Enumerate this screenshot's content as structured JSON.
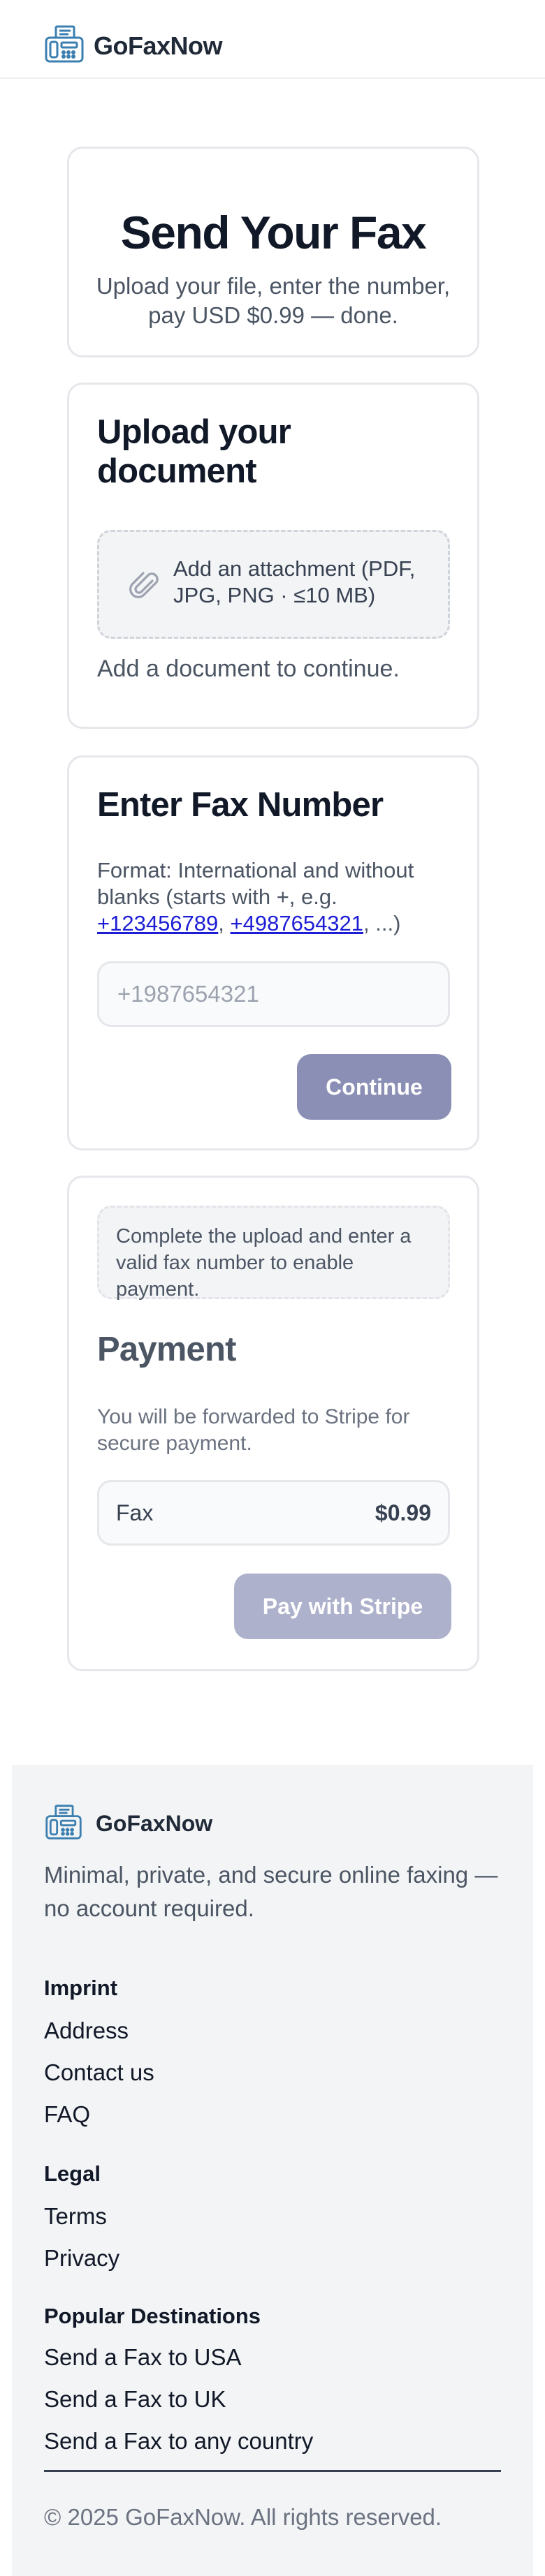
{
  "header": {
    "brand": "GoFaxNow",
    "logo_icon": "fax-machine-icon"
  },
  "hero": {
    "title": "Send Your Fax",
    "subtitle": "Upload your file, enter the number, pay USD $0.99 — done."
  },
  "upload": {
    "title": "Upload your document",
    "dropzone_label": "Add an attachment (PDF, JPG, PNG · ≤10 MB)",
    "dropzone_icon": "paperclip-icon",
    "hint": "Add a document to continue."
  },
  "fax_number": {
    "title": "Enter Fax Number",
    "format_prefix": "Format: International and without blanks (starts with +, e.g. ",
    "example_1": "+123456789",
    "separator": ", ",
    "example_2": "+4987654321",
    "format_suffix": ", ...)",
    "input_value": "",
    "input_placeholder": "+1987654321",
    "continue_label": "Continue"
  },
  "payment": {
    "notice": "Complete the upload and enter a valid fax number to enable payment.",
    "title": "Payment",
    "subtitle": "You will be forwarded to Stripe for secure payment.",
    "item_label": "Fax",
    "item_price": "$0.99",
    "pay_label": "Pay with Stripe"
  },
  "footer": {
    "brand": "GoFaxNow",
    "tagline": "Minimal, private, and secure online faxing — no account required.",
    "sections": [
      {
        "heading": "Imprint",
        "links": [
          "Address",
          "Contact us",
          "FAQ"
        ]
      },
      {
        "heading": "Legal",
        "links": [
          "Terms",
          "Privacy"
        ]
      },
      {
        "heading": "Popular Destinations",
        "links": [
          "Send a Fax to USA",
          "Send a Fax to UK",
          "Send a Fax to any country"
        ]
      }
    ],
    "copyright": "© 2025 GoFaxNow. All rights reserved."
  },
  "colors": {
    "accent": "#8b8fb5",
    "accent_disabled": "#aeb1cb",
    "logo_blue": "#3b7fb0",
    "link": "#1d1dd6"
  }
}
